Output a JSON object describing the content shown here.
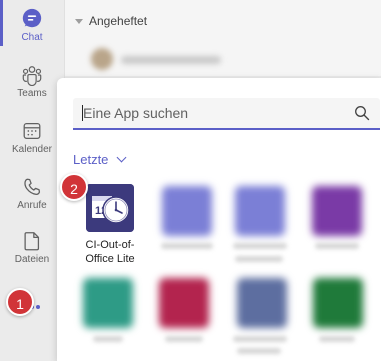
{
  "rail": {
    "items": [
      {
        "label": "Chat",
        "icon": "chat-icon"
      },
      {
        "label": "Teams",
        "icon": "teams-icon"
      },
      {
        "label": "Kalender",
        "icon": "calendar-icon"
      },
      {
        "label": "Anrufe",
        "icon": "phone-icon"
      },
      {
        "label": "Dateien",
        "icon": "file-icon"
      }
    ],
    "more_icon": "more-dots-icon"
  },
  "chatlist": {
    "pinned_label": "Angeheftet"
  },
  "flyout": {
    "search_placeholder": "Eine App suchen",
    "recent_label": "Letzte",
    "app": {
      "name": "CI-Out-of-Office Lite",
      "icon": "calendar-clock-icon"
    }
  },
  "badges": {
    "step1": "1",
    "step2": "2"
  },
  "colors": {
    "accent": "#5b5fc7",
    "badge": "#d13438",
    "rail_bg": "#ebebeb"
  }
}
